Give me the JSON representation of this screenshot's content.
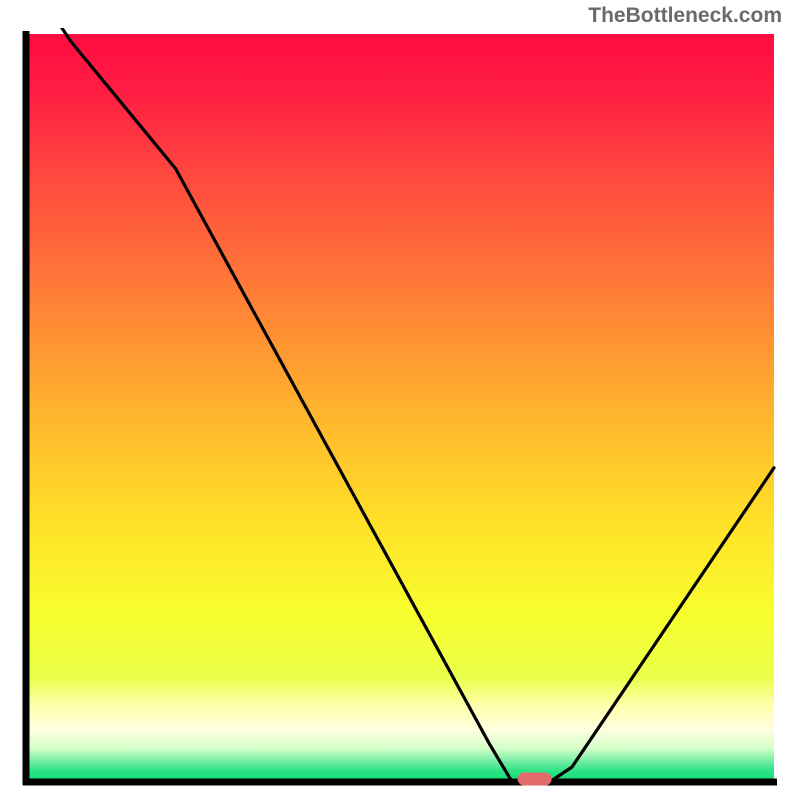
{
  "watermark": "TheBottleneck.com",
  "chart_data": {
    "type": "line",
    "title": "",
    "xlabel": "",
    "ylabel": "",
    "xlim": [
      0,
      100
    ],
    "ylim": [
      0,
      100
    ],
    "x": [
      0,
      6,
      20,
      62,
      65,
      70,
      73,
      100
    ],
    "values": [
      108,
      99,
      82,
      5,
      0,
      0,
      2,
      42
    ],
    "marker": {
      "x": 68,
      "y": 0,
      "color": "#e26a6a"
    },
    "background_gradient": {
      "stops": [
        {
          "offset": 0.0,
          "color": "#ff0b40"
        },
        {
          "offset": 0.08,
          "color": "#ff1f43"
        },
        {
          "offset": 0.2,
          "color": "#ff4c3e"
        },
        {
          "offset": 0.35,
          "color": "#ff7e37"
        },
        {
          "offset": 0.5,
          "color": "#ffb22e"
        },
        {
          "offset": 0.65,
          "color": "#ffe027"
        },
        {
          "offset": 0.78,
          "color": "#f8ff2f"
        },
        {
          "offset": 0.86,
          "color": "#eaff4a"
        },
        {
          "offset": 0.9,
          "color": "#ffffb0"
        },
        {
          "offset": 0.93,
          "color": "#ffffe0"
        },
        {
          "offset": 0.955,
          "color": "#d4ffc8"
        },
        {
          "offset": 0.97,
          "color": "#80f0a8"
        },
        {
          "offset": 0.985,
          "color": "#2de384"
        },
        {
          "offset": 1.0,
          "color": "#0ee076"
        }
      ]
    }
  }
}
